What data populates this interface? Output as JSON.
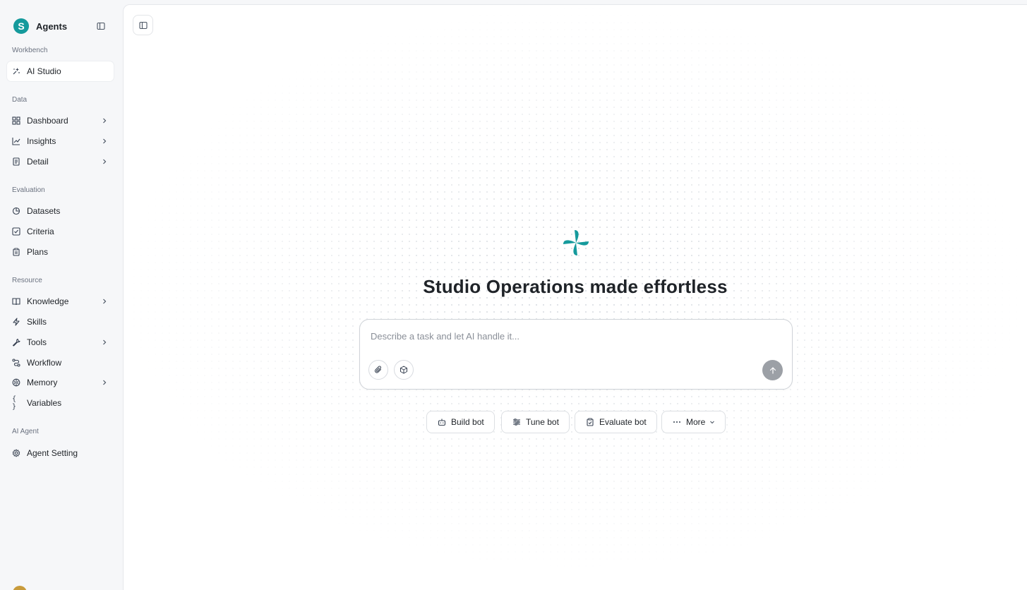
{
  "app": {
    "brand_initial": "S",
    "brand_name": "Agents",
    "accent_color": "#159a9c"
  },
  "sidebar": {
    "sections": {
      "workbench": "Workbench",
      "data": "Data",
      "evaluation": "Evaluation",
      "resource": "Resource",
      "ai_agent": "AI Agent"
    },
    "items": {
      "ai_studio": {
        "label": "AI Studio",
        "icon": "sparkle-icon",
        "active": true
      },
      "dashboard": {
        "label": "Dashboard",
        "icon": "grid-icon",
        "expandable": true
      },
      "insights": {
        "label": "Insights",
        "icon": "line-chart-icon",
        "expandable": true
      },
      "detail": {
        "label": "Detail",
        "icon": "file-icon",
        "expandable": true
      },
      "datasets": {
        "label": "Datasets",
        "icon": "pie-icon"
      },
      "criteria": {
        "label": "Criteria",
        "icon": "check-square-icon"
      },
      "plans": {
        "label": "Plans",
        "icon": "clipboard-icon"
      },
      "knowledge": {
        "label": "Knowledge",
        "icon": "book-icon",
        "expandable": true
      },
      "skills": {
        "label": "Skills",
        "icon": "bolt-icon"
      },
      "tools": {
        "label": "Tools",
        "icon": "wrench-icon",
        "expandable": true
      },
      "workflow": {
        "label": "Workflow",
        "icon": "route-icon"
      },
      "memory": {
        "label": "Memory",
        "icon": "brain-icon",
        "expandable": true
      },
      "variables": {
        "label": "Variables",
        "icon": "braces-icon"
      },
      "agent_setting": {
        "label": "Agent Setting",
        "icon": "gear-icon"
      }
    },
    "variables_glyph": "{ }"
  },
  "main": {
    "title": "Studio Operations made effortless",
    "prompt": {
      "placeholder": "Describe a task and let AI handle it...",
      "value": ""
    },
    "actions": {
      "build": "Build bot",
      "tune": "Tune bot",
      "evaluate": "Evaluate bot",
      "more": "More"
    }
  }
}
